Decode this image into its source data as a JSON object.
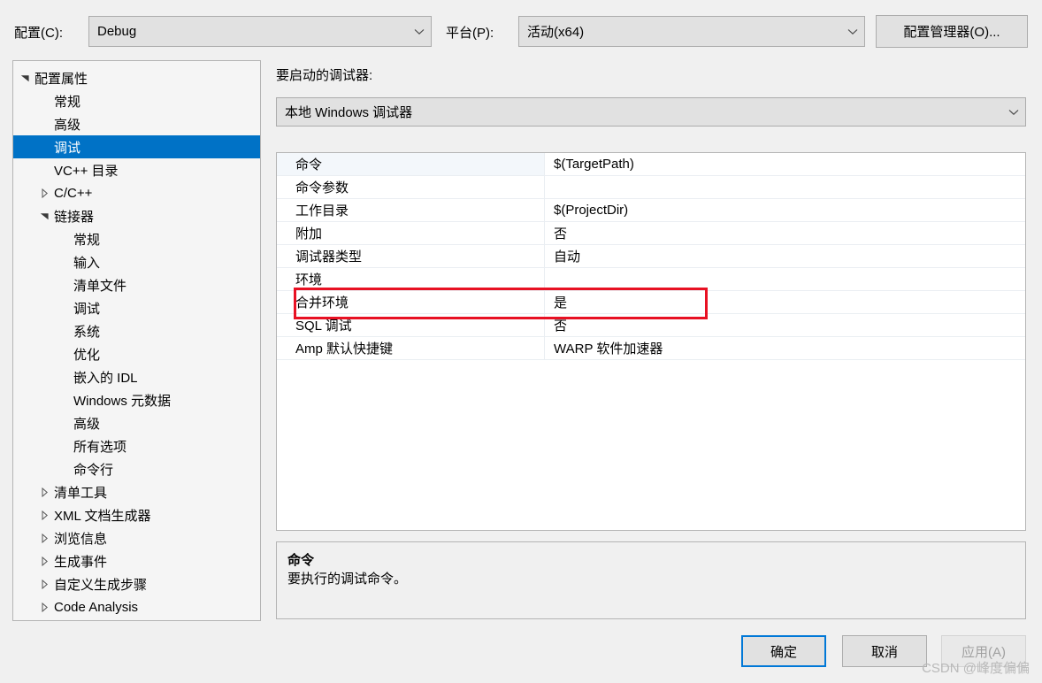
{
  "toolbar": {
    "config_label": "配置(C):",
    "config_value": "Debug",
    "platform_label": "平台(P):",
    "platform_value": "活动(x64)",
    "config_manager_button": "配置管理器(O)..."
  },
  "tree": {
    "items": [
      {
        "label": "配置属性",
        "level": 0,
        "expander": "expanded",
        "selected": false
      },
      {
        "label": "常规",
        "level": 1,
        "expander": "none",
        "selected": false
      },
      {
        "label": "高级",
        "level": 1,
        "expander": "none",
        "selected": false
      },
      {
        "label": "调试",
        "level": 1,
        "expander": "none",
        "selected": true
      },
      {
        "label": "VC++ 目录",
        "level": 1,
        "expander": "none",
        "selected": false
      },
      {
        "label": "C/C++",
        "level": 1,
        "expander": "collapsed",
        "selected": false
      },
      {
        "label": "链接器",
        "level": 1,
        "expander": "expanded",
        "selected": false
      },
      {
        "label": "常规",
        "level": 2,
        "expander": "none",
        "selected": false
      },
      {
        "label": "输入",
        "level": 2,
        "expander": "none",
        "selected": false
      },
      {
        "label": "清单文件",
        "level": 2,
        "expander": "none",
        "selected": false
      },
      {
        "label": "调试",
        "level": 2,
        "expander": "none",
        "selected": false
      },
      {
        "label": "系统",
        "level": 2,
        "expander": "none",
        "selected": false
      },
      {
        "label": "优化",
        "level": 2,
        "expander": "none",
        "selected": false
      },
      {
        "label": "嵌入的 IDL",
        "level": 2,
        "expander": "none",
        "selected": false
      },
      {
        "label": "Windows 元数据",
        "level": 2,
        "expander": "none",
        "selected": false
      },
      {
        "label": "高级",
        "level": 2,
        "expander": "none",
        "selected": false
      },
      {
        "label": "所有选项",
        "level": 2,
        "expander": "none",
        "selected": false
      },
      {
        "label": "命令行",
        "level": 2,
        "expander": "none",
        "selected": false
      },
      {
        "label": "清单工具",
        "level": 1,
        "expander": "collapsed",
        "selected": false
      },
      {
        "label": "XML 文档生成器",
        "level": 1,
        "expander": "collapsed",
        "selected": false
      },
      {
        "label": "浏览信息",
        "level": 1,
        "expander": "collapsed",
        "selected": false
      },
      {
        "label": "生成事件",
        "level": 1,
        "expander": "collapsed",
        "selected": false
      },
      {
        "label": "自定义生成步骤",
        "level": 1,
        "expander": "collapsed",
        "selected": false
      },
      {
        "label": "Code Analysis",
        "level": 1,
        "expander": "collapsed",
        "selected": false
      }
    ]
  },
  "main": {
    "launch_label": "要启动的调试器:",
    "debugger_value": "本地 Windows 调试器",
    "properties": [
      {
        "name": "命令",
        "value": "$(TargetPath)",
        "selected": true
      },
      {
        "name": "命令参数",
        "value": "",
        "selected": false
      },
      {
        "name": "工作目录",
        "value": "$(ProjectDir)",
        "selected": false
      },
      {
        "name": "附加",
        "value": "否",
        "selected": false
      },
      {
        "name": "调试器类型",
        "value": "自动",
        "selected": false
      },
      {
        "name": "环境",
        "value": "",
        "selected": false
      },
      {
        "name": "合并环境",
        "value": "是",
        "selected": false
      },
      {
        "name": "SQL 调试",
        "value": "否",
        "selected": false
      },
      {
        "name": "Amp 默认快捷键",
        "value": "WARP 软件加速器",
        "selected": false
      }
    ],
    "annotation_color": "#e81123",
    "description": {
      "title": "命令",
      "body": "要执行的调试命令。"
    }
  },
  "footer": {
    "ok_label": "确定",
    "cancel_label": "取消",
    "apply_label": "应用(A)",
    "watermark": "CSDN @峰度偏偏"
  }
}
